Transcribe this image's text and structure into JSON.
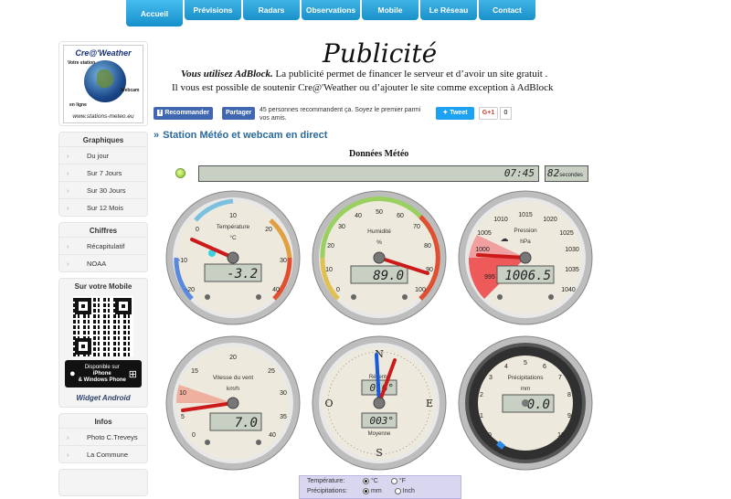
{
  "nav": {
    "tabs": [
      "Accueil",
      "Prévisions",
      "Radars",
      "Observations",
      "Mobile",
      "Le Réseau",
      "Contact"
    ],
    "active": "Accueil"
  },
  "logo": {
    "title": "Cre@'Weather",
    "station_label": "Votre station",
    "webcam_label": "Webcam",
    "online_label": "en ligne",
    "url": "www.stations-meteo.eu"
  },
  "sidebar": {
    "graphiques": {
      "title": "Graphiques",
      "items": [
        "Du jour",
        "Sur 7 Jours",
        "Sur 30 Jours",
        "Sur 12 Mois"
      ]
    },
    "chiffres": {
      "title": "Chiffres",
      "items": [
        "Récapitulatif",
        "NOAA"
      ]
    },
    "mobile": {
      "title": "Sur votre Mobile",
      "store_line1": "Disponible sur",
      "store_line2": "iPhone",
      "store_line3": "&",
      "store_line4": "Windows Phone",
      "widget": "Widget Android"
    },
    "infos": {
      "title": "Infos",
      "items": [
        "Photo C.Treveys",
        "La Commune"
      ]
    }
  },
  "ad": {
    "title": "Publicité",
    "line1_bold": "Vous utilisez AdBlock.",
    "line1_rest": " La publicité permet de financer le serveur et d’avoir un site gratuit .",
    "line2": "Il vous est possible de soutenir Cre@'Weather ou d’ajouter le site comme exception à AdBlock"
  },
  "social": {
    "fb_recommend": "Recommander",
    "fb_share": "Partager",
    "fb_text": "45 personnes recommandent ça. Soyez le premier parmi vos amis.",
    "tweet": "Tweet",
    "gplus": "G+1",
    "gplus_count": "0"
  },
  "section_title": "Station Météo et webcam en direct",
  "donnees_title": "Données Météo",
  "time": "07:45",
  "seconds": {
    "value": "82",
    "unit": "secondes"
  },
  "gauges": {
    "temperature": {
      "label": "Température",
      "unit": "°C",
      "value": "-3.2",
      "min": -20,
      "max": 40,
      "ticks": [
        "-20",
        "-10",
        "0",
        "10",
        "20",
        "30",
        "40"
      ]
    },
    "humidite": {
      "label": "Humidité",
      "unit": "%",
      "value": "89.0",
      "min": 0,
      "max": 100,
      "ticks": [
        "0",
        "10",
        "20",
        "30",
        "40",
        "50",
        "60",
        "70",
        "80",
        "90",
        "100"
      ]
    },
    "pression": {
      "label": "Pression",
      "unit": "hPa",
      "value": "1006.5",
      "min": 990,
      "max": 1040,
      "ticks": [
        "990",
        "995",
        "1000",
        "1005",
        "1010",
        "1015",
        "1020",
        "1025",
        "1030",
        "1035",
        "1040"
      ]
    },
    "vent": {
      "label": "Vitesse du vent",
      "unit": "km/h",
      "value": "7.0",
      "min": 0,
      "max": 40,
      "ticks": [
        "0",
        "5",
        "10",
        "15",
        "20",
        "25",
        "30",
        "35",
        "40"
      ]
    },
    "direction": {
      "label_top": "Récente",
      "label_bottom": "Moyenne",
      "value_top": "016°",
      "value_bottom": "003°",
      "cardinals": [
        "N",
        "E",
        "S",
        "O"
      ]
    },
    "precipitations": {
      "label": "Précipitations",
      "unit": "mm",
      "value": "0.0",
      "min": 0,
      "max": 10,
      "ticks": [
        "0",
        "1",
        "2",
        "3",
        "4",
        "5",
        "6",
        "7",
        "8",
        "9",
        "10"
      ]
    }
  },
  "units": {
    "temp_label": "Température:",
    "temp_opts": [
      "°C",
      "°F"
    ],
    "precip_label": "Précipitations:",
    "precip_opts": [
      "mm",
      "Inch"
    ]
  }
}
